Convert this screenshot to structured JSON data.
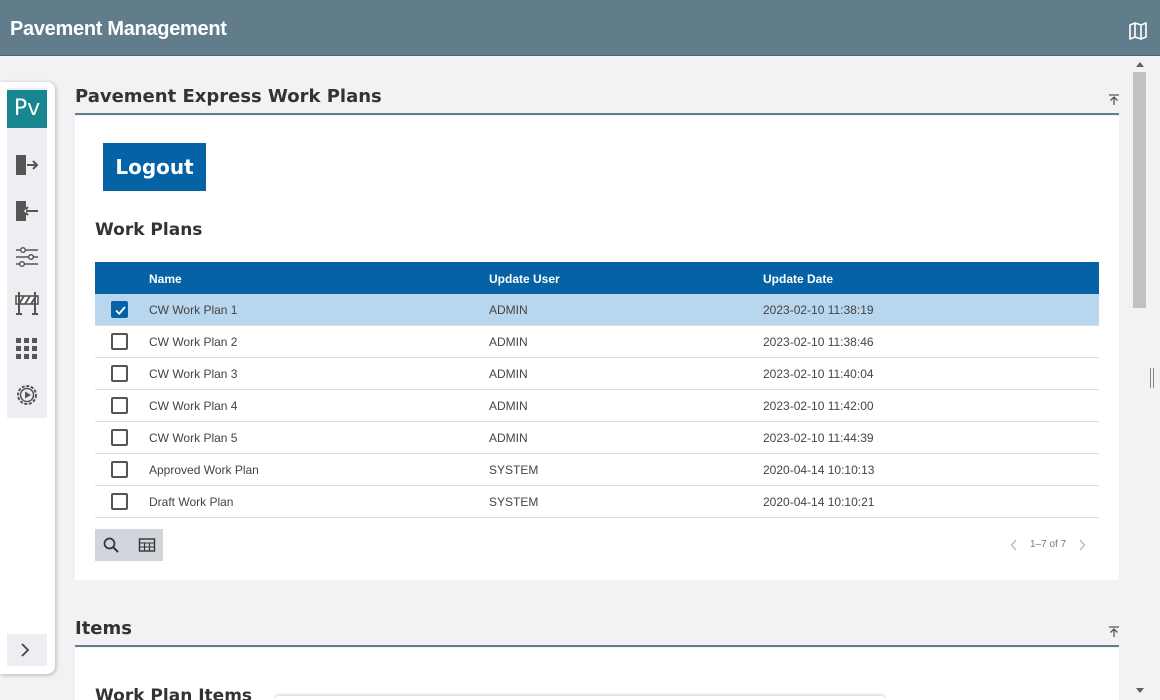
{
  "app": {
    "title": "Pavement Management"
  },
  "rail": {
    "logo": "Pv",
    "icons": [
      "login-icon",
      "logout-icon",
      "sliders-icon",
      "barrier-icon",
      "grid-apps-icon",
      "settings-play-icon"
    ],
    "expand_icon": "chevron-right-icon"
  },
  "section1": {
    "title": "Pavement Express Work Plans"
  },
  "logout_label": "Logout",
  "workplans": {
    "title": "Work Plans",
    "columns": [
      "Name",
      "Update User",
      "Update Date"
    ],
    "rows": [
      {
        "name": "CW Work Plan 1",
        "user": "ADMIN",
        "date": "2023-02-10 11:38:19",
        "checked": true
      },
      {
        "name": "CW Work Plan 2",
        "user": "ADMIN",
        "date": "2023-02-10 11:38:46",
        "checked": false
      },
      {
        "name": "CW Work Plan 3",
        "user": "ADMIN",
        "date": "2023-02-10 11:40:04",
        "checked": false
      },
      {
        "name": "CW Work Plan 4",
        "user": "ADMIN",
        "date": "2023-02-10 11:42:00",
        "checked": false
      },
      {
        "name": "CW Work Plan 5",
        "user": "ADMIN",
        "date": "2023-02-10 11:44:39",
        "checked": false
      },
      {
        "name": "Approved Work Plan",
        "user": "SYSTEM",
        "date": "2020-04-14 10:10:13",
        "checked": false
      },
      {
        "name": "Draft Work Plan",
        "user": "SYSTEM",
        "date": "2020-04-14 10:10:21",
        "checked": false
      }
    ],
    "pager": "1–7 of 7"
  },
  "section2": {
    "title": "Items",
    "subtitle": "Work Plan Items"
  },
  "colors": {
    "header": "#617d8b",
    "accent": "#0562a4",
    "logo": "#17868e",
    "selected_row": "#b8d6ee"
  }
}
